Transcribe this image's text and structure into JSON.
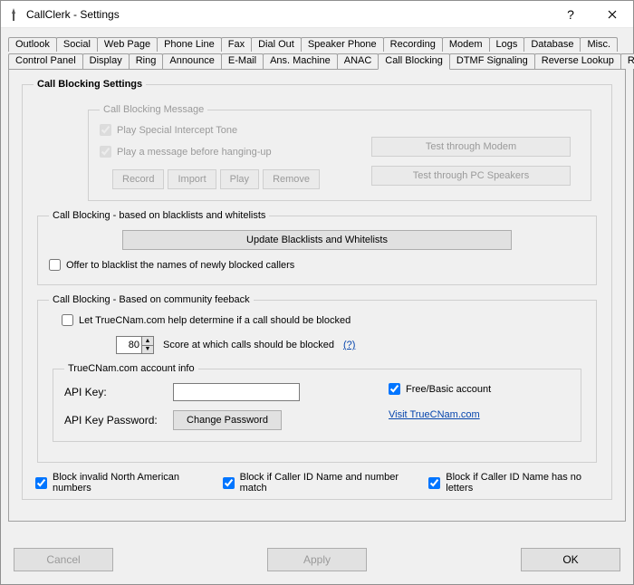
{
  "window": {
    "title": "CallClerk - Settings"
  },
  "tabs_row1": [
    "Outlook",
    "Social",
    "Web Page",
    "Phone Line",
    "Fax",
    "Dial Out",
    "Speaker Phone",
    "Recording",
    "Modem",
    "Logs",
    "Database",
    "Misc."
  ],
  "tabs_row2": [
    "Control Panel",
    "Display",
    "Ring",
    "Announce",
    "E-Mail",
    "Ans. Machine",
    "ANAC",
    "Call Blocking",
    "DTMF Signaling",
    "Reverse Lookup",
    "Run Program"
  ],
  "active_tab": "Call Blocking",
  "settings": {
    "legend": "Call Blocking Settings"
  },
  "msg": {
    "legend": "Call Blocking Message",
    "play_tone": "Play Special Intercept Tone",
    "play_msg": "Play a message before hanging-up",
    "record": "Record",
    "import": "Import",
    "play": "Play",
    "remove": "Remove",
    "test_modem": "Test through Modem",
    "test_speakers": "Test through PC Speakers"
  },
  "lists": {
    "legend": "Call Blocking - based on blacklists and whitelists",
    "update": "Update Blacklists and Whitelists",
    "offer": "Offer to blacklist the names of newly blocked callers"
  },
  "community": {
    "legend": "Call Blocking - Based on community feeback",
    "let_truecnam": "Let TrueCNam.com help determine if a call should be blocked",
    "score_value": "80",
    "score_label": "Score at which calls should be blocked",
    "help": "(?)",
    "acct_legend": "TrueCNam.com account info",
    "api_key": "API Key:",
    "api_pass": "API Key Password:",
    "change_pw": "Change Password",
    "free_basic": "Free/Basic account",
    "visit": "Visit TrueCNam.com"
  },
  "bottom_checks": {
    "invalid_na": "Block invalid North American numbers",
    "name_num_match": "Block if Caller ID Name and number match",
    "no_letters": "Block if Caller ID Name has no letters"
  },
  "buttons": {
    "cancel": "Cancel",
    "apply": "Apply",
    "ok": "OK"
  }
}
